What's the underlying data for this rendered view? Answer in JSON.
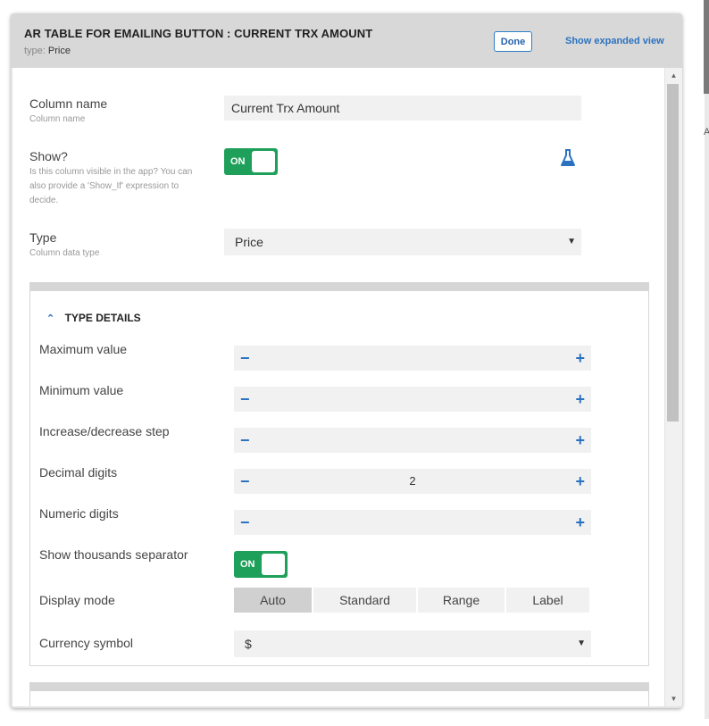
{
  "dialog": {
    "title": "AR TABLE FOR EMAILING BUTTON : CURRENT TRX AMOUNT",
    "type_prefix": "type:",
    "type_value": "Price",
    "done_label": "Done",
    "expand_label": "Show expanded view"
  },
  "backdrop": {
    "partial_text": "A"
  },
  "fields": {
    "column_name": {
      "label": "Column name",
      "hint": "Column name",
      "value": "Current Trx Amount"
    },
    "show": {
      "label": "Show?",
      "hint": "Is this column visible in the app? You can also provide a 'Show_If' expression to decide.",
      "toggle": "ON",
      "toggle_on": true,
      "icon": "flask-icon"
    },
    "type": {
      "label": "Type",
      "hint": "Column data type",
      "value": "Price"
    }
  },
  "type_details": {
    "heading": "TYPE DETAILS",
    "maximum_value": {
      "label": "Maximum value",
      "value": "",
      "minus": "−",
      "plus": "+"
    },
    "minimum_value": {
      "label": "Minimum value",
      "value": "",
      "minus": "−",
      "plus": "+"
    },
    "step": {
      "label": "Increase/decrease step",
      "value": "",
      "minus": "−",
      "plus": "+"
    },
    "decimal_digits": {
      "label": "Decimal digits",
      "value": "2",
      "minus": "−",
      "plus": "+"
    },
    "numeric_digits": {
      "label": "Numeric digits",
      "value": "",
      "minus": "−",
      "plus": "+"
    },
    "thousands_separator": {
      "label": "Show thousands separator",
      "toggle": "ON",
      "toggle_on": true
    },
    "display_mode": {
      "label": "Display mode",
      "options": [
        "Auto",
        "Standard",
        "Range",
        "Label"
      ],
      "selected": "Auto"
    },
    "currency_symbol": {
      "label": "Currency symbol",
      "value": "$"
    }
  },
  "colors": {
    "accent": "#2a72c0",
    "toggle_on": "#1ea05a",
    "header_bg": "#d8d8d8"
  }
}
